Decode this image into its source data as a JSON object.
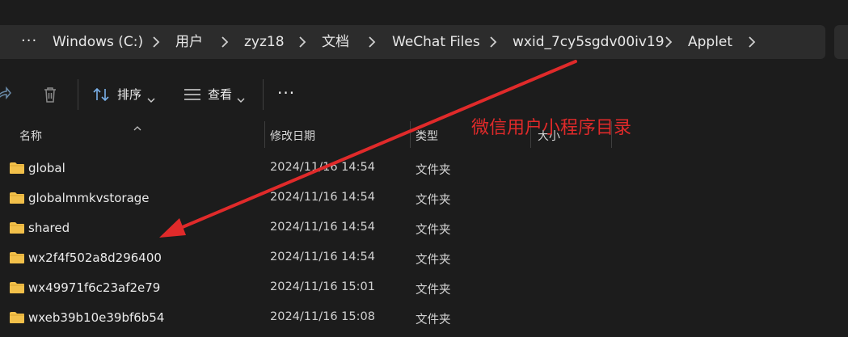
{
  "breadcrumb": {
    "overflow_label": "···",
    "items": [
      "Windows (C:)",
      "用户",
      "zyz18",
      "文档",
      "WeChat Files",
      "wxid_7cy5sgdv00iv19",
      "Applet"
    ]
  },
  "toolbar": {
    "sort_label": "排序",
    "view_label": "查看",
    "more_label": "···"
  },
  "columns": {
    "name": "名称",
    "modified": "修改日期",
    "type": "类型",
    "size": "大小"
  },
  "files": [
    {
      "name": "global",
      "modified": "2024/11/16 14:54",
      "type": "文件夹"
    },
    {
      "name": "globalmmkvstorage",
      "modified": "2024/11/16 14:54",
      "type": "文件夹"
    },
    {
      "name": "shared",
      "modified": "2024/11/16 14:54",
      "type": "文件夹"
    },
    {
      "name": "wx2f4f502a8d296400",
      "modified": "2024/11/16 14:54",
      "type": "文件夹"
    },
    {
      "name": "wx49971f6c23af2e79",
      "modified": "2024/11/16 15:01",
      "type": "文件夹"
    },
    {
      "name": "wxeb39b10e39bf6b54",
      "modified": "2024/11/16 15:08",
      "type": "文件夹"
    }
  ],
  "annotation": {
    "text": "微信用户小程序目录",
    "color": "#e02a2a"
  },
  "colors": {
    "background": "#1c1c1c",
    "address_bar": "#2c2c2c",
    "folder": "#f2c04a"
  }
}
